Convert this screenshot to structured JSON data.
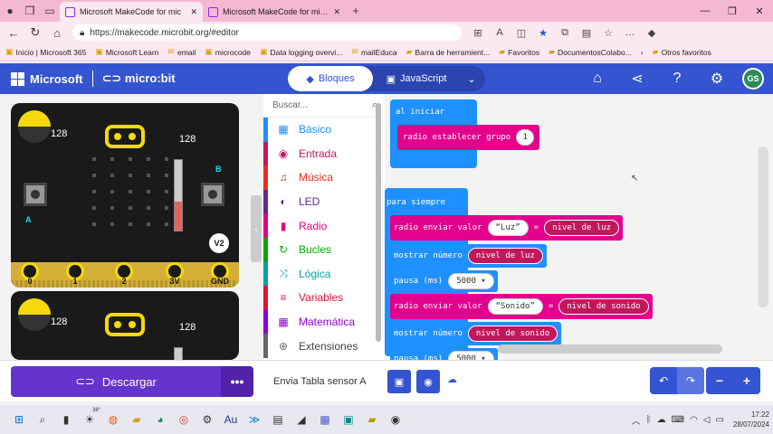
{
  "browser": {
    "tabs": [
      {
        "title": "Microsoft MakeCode for mic",
        "active": true
      },
      {
        "title": "Microsoft MakeCode for micro",
        "active": false
      }
    ],
    "url": "https://makecode.microbit.org/#editor",
    "bookmarks": [
      "Inicio | Microsoft 365",
      "Microsoft Learn",
      "email",
      "microcode",
      "Data logging overvi...",
      "mailEduca",
      "Barra de herramient...",
      "Favoritos",
      "DocumentosColabo...",
      "Otros favoritos"
    ]
  },
  "header": {
    "brand": "Microsoft",
    "product": "micro:bit",
    "mode_blocks": "Bloques",
    "mode_js": "JavaScript",
    "avatar": "GS"
  },
  "simulator": {
    "light_level": "128",
    "temperature": "128",
    "button_a": "A",
    "button_b": "B",
    "version": "V2",
    "pins": [
      "0",
      "1",
      "2",
      "3V",
      "GND"
    ],
    "light_level_2": "128",
    "temperature_2": "128"
  },
  "toolbox": {
    "search_placeholder": "Buscar...",
    "categories": [
      {
        "label": "Básico",
        "color": "#1e90ff",
        "icon": "▦"
      },
      {
        "label": "Entrada",
        "color": "#c2185b",
        "icon": "◉"
      },
      {
        "label": "Música",
        "color": "#e63022",
        "icon": "♫"
      },
      {
        "label": "LED",
        "color": "#5c2d91",
        "icon": "◐"
      },
      {
        "label": "Radio",
        "color": "#e3008c",
        "icon": "▮"
      },
      {
        "label": "Bucles",
        "color": "#00aa00",
        "icon": "↻"
      },
      {
        "label": "Lógica",
        "color": "#00a4a6",
        "icon": "⤨"
      },
      {
        "label": "Variables",
        "color": "#dc143c",
        "icon": "≡"
      },
      {
        "label": "Matemática",
        "color": "#9400d3",
        "icon": "▦"
      },
      {
        "label": "Extensiones",
        "color": "#666666",
        "icon": "⊕"
      }
    ]
  },
  "workspace": {
    "on_start": "al iniciar",
    "radio_group": "radio establecer grupo",
    "radio_group_value": "1",
    "forever": "para siempre",
    "send_value_1": "radio enviar valor",
    "luz_str": "Luz",
    "equals": "=",
    "light_level_block": "nivel de luz",
    "show_number_1": "mostrar número",
    "pause": "pausa (ms)",
    "pause_value": "5000",
    "send_value_2": "radio enviar valor",
    "sonido_str": "Sonido",
    "sound_level_block": "nivel de sonido",
    "show_number_2": "mostrar número",
    "pause_value_2": "5000"
  },
  "bottombar": {
    "download": "Descargar",
    "project_name": "Envia Tabla sensor A"
  },
  "taskbar": {
    "weather": "38°",
    "time": "17:22",
    "date": "28/07/2024"
  }
}
